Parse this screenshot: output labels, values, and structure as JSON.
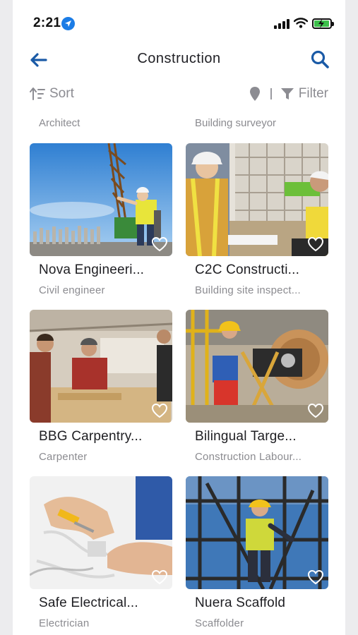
{
  "status": {
    "time": "2:21"
  },
  "header": {
    "title": "Construction"
  },
  "toolbar": {
    "sort_label": "Sort",
    "filter_label": "Filter"
  },
  "previous_row": {
    "left_role": "Architect",
    "right_role": "Building surveyor"
  },
  "listings": [
    {
      "name": "Nova Engineeri...",
      "role": "Civil engineer"
    },
    {
      "name": "C2C Constructi...",
      "role": "Building site inspect..."
    },
    {
      "name": "BBG Carpentry...",
      "role": "Carpenter"
    },
    {
      "name": "Bilingual Targe...",
      "role": "Construction Labour..."
    },
    {
      "name": "Safe Electrical...",
      "role": "Electrician"
    },
    {
      "name": "Nuera Scaffold",
      "role": "Scaffolder"
    }
  ],
  "colors": {
    "accent": "#1a5aa6",
    "muted_text": "#8b8b90",
    "battery_green": "#3dc14b",
    "location_blue": "#1b7ce6"
  },
  "icons": [
    "location-arrow-icon",
    "signal-icon",
    "wifi-icon",
    "battery-icon",
    "back-arrow-icon",
    "search-icon",
    "sort-icon",
    "map-pin-icon",
    "filter-icon",
    "heart-icon"
  ]
}
